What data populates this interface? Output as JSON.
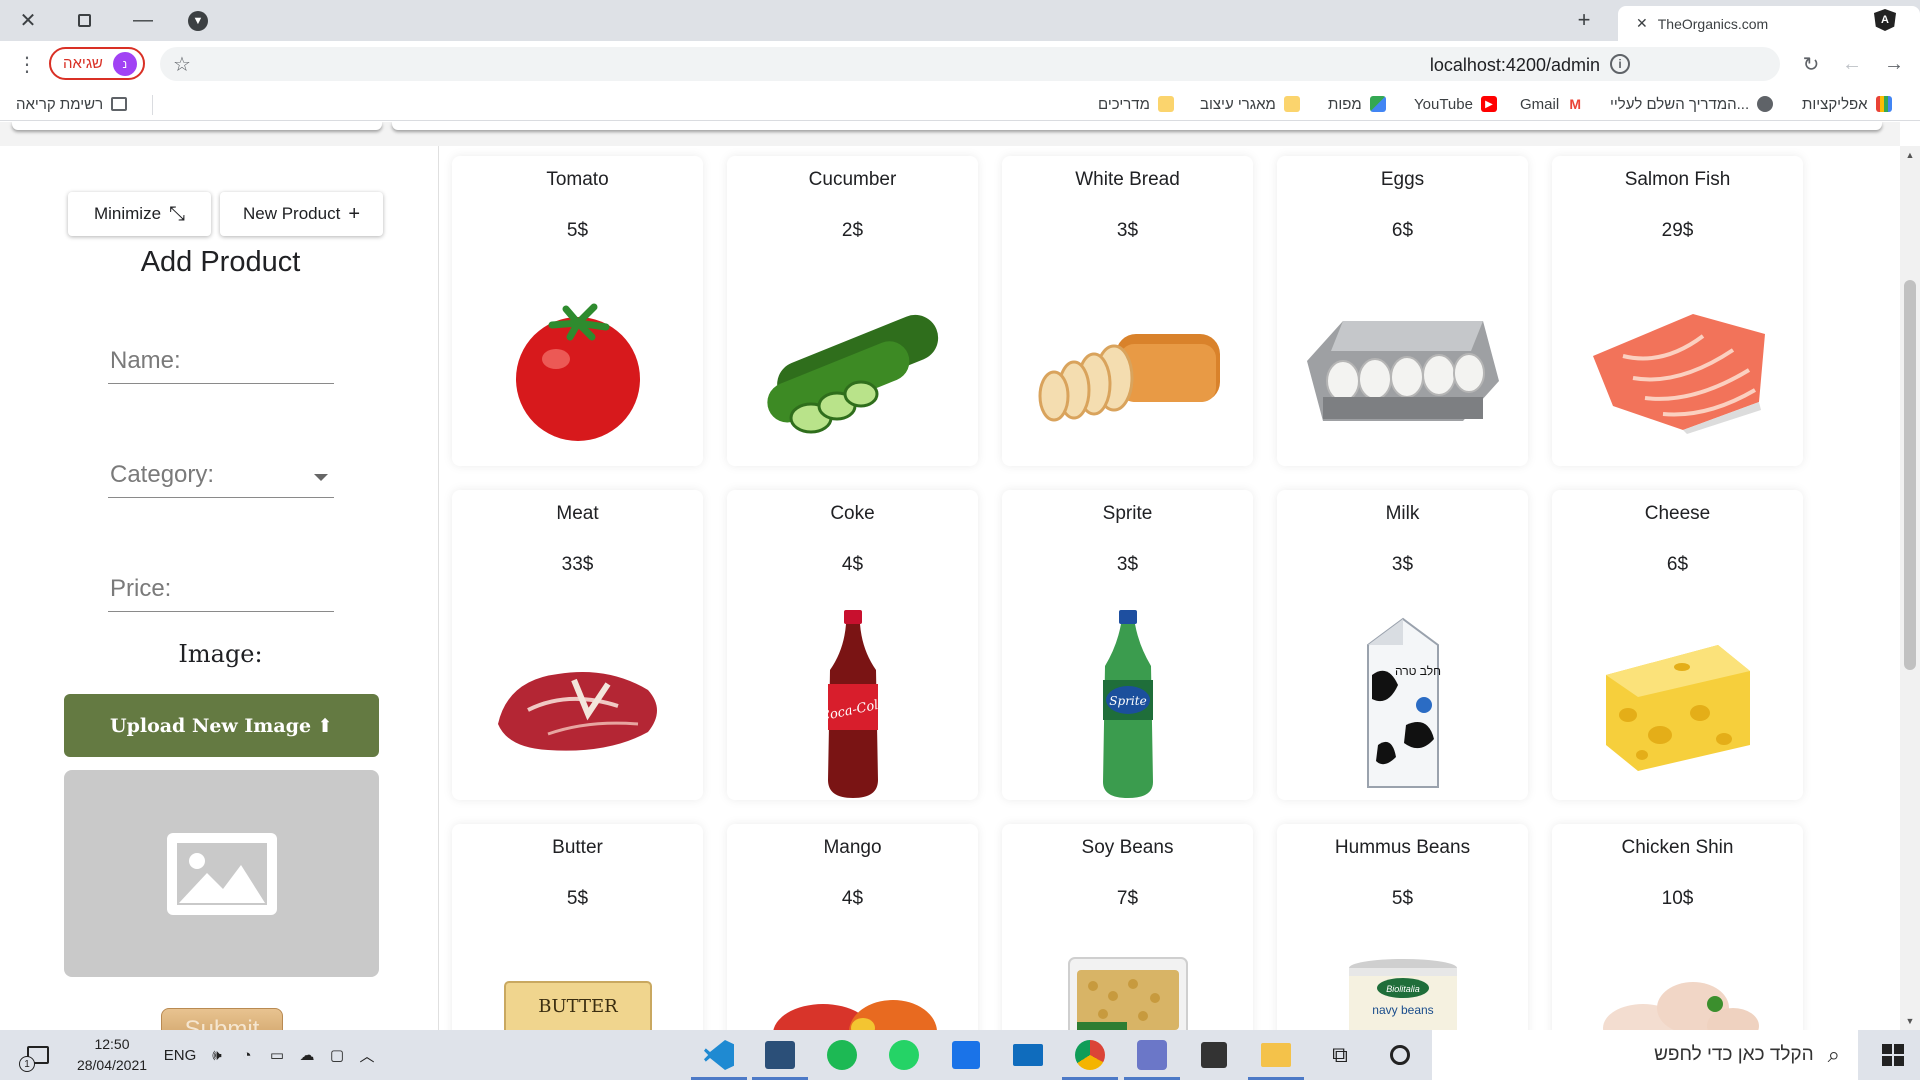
{
  "browser": {
    "tab_title": "TheOrganics.com",
    "url": "localhost:4200/admin",
    "profile_label": "שגיאה",
    "profile_initial": "נ",
    "new_tab_symbol": "+"
  },
  "bookmarks": [
    {
      "label": "אפליקציות",
      "icon": "apps-grid-icon",
      "color": "#e94235"
    },
    {
      "label": "המדריך השלם לעליי...",
      "icon": "globe-icon",
      "color": "#5f6368"
    },
    {
      "label": "Gmail",
      "icon": "gmail-icon",
      "color": "#ea4335"
    },
    {
      "label": "YouTube",
      "icon": "youtube-icon",
      "color": "#ff0000"
    },
    {
      "label": "מפות",
      "icon": "maps-icon",
      "color": "#34a853"
    },
    {
      "label": "מאגרי עיצוב",
      "icon": "folder-icon",
      "color": "#fbd46d"
    },
    {
      "label": "מדריכים",
      "icon": "folder-icon",
      "color": "#fbd46d"
    }
  ],
  "reading_list": "רשימת קריאה",
  "admin_panel": {
    "minimize_label": "Minimize",
    "new_product_label": "New Product",
    "title": "Add Product",
    "name_placeholder": "Name:",
    "category_placeholder": "Category:",
    "price_placeholder": "Price:",
    "image_label": "Image:",
    "upload_label": "Upload New Image",
    "submit_label": "Submit"
  },
  "products": [
    {
      "name": "Tomato",
      "price": "5$"
    },
    {
      "name": "Cucumber",
      "price": "2$"
    },
    {
      "name": "White Bread",
      "price": "3$"
    },
    {
      "name": "Eggs",
      "price": "6$"
    },
    {
      "name": "Salmon Fish",
      "price": "29$"
    },
    {
      "name": "Meat",
      "price": "33$"
    },
    {
      "name": "Coke",
      "price": "4$"
    },
    {
      "name": "Sprite",
      "price": "3$"
    },
    {
      "name": "Milk",
      "price": "3$"
    },
    {
      "name": "Cheese",
      "price": "6$"
    },
    {
      "name": "Butter",
      "price": "5$"
    },
    {
      "name": "Mango",
      "price": "4$"
    },
    {
      "name": "Soy Beans",
      "price": "7$"
    },
    {
      "name": "Hummus Beans",
      "price": "5$"
    },
    {
      "name": "Chicken Shin",
      "price": "10$"
    }
  ],
  "product_image_text": {
    "coke_logo": "Coca-Cola",
    "sprite_logo": "Sprite",
    "milk_label": "חלב טרה",
    "butter_label": "BUTTER",
    "beans_brand": "Biolitalia",
    "beans_label": "navy beans"
  },
  "taskbar": {
    "time": "12:50",
    "date": "28/04/2021",
    "language": "ENG",
    "notification_count": "1",
    "search_placeholder": "הקלד כאן כדי לחפש"
  }
}
